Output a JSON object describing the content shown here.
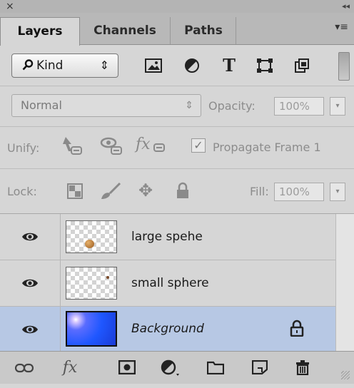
{
  "window": {
    "close_glyph": "×",
    "collapse_glyph": "◂◂"
  },
  "tabs": [
    {
      "label": "Layers",
      "active": true
    },
    {
      "label": "Channels",
      "active": false
    },
    {
      "label": "Paths",
      "active": false
    }
  ],
  "panel_menu_glyph": "▾≡",
  "filter": {
    "kind_label": "Kind",
    "kind_icon": "search-icon",
    "select_arrows": "⇕",
    "icons": [
      "pixel-layer-filter-icon",
      "adjustment-layer-filter-icon",
      "type-layer-filter-icon",
      "shape-layer-filter-icon",
      "smart-object-filter-icon"
    ],
    "type_glyph": "T"
  },
  "blend": {
    "mode": "Normal",
    "select_arrows": "⇕",
    "opacity_label": "Opacity:",
    "opacity_value": "100%",
    "dropdown_glyph": "▾"
  },
  "unify": {
    "label": "Unify:",
    "fx_glyph": "fx",
    "propagate_label": "Propagate Frame 1",
    "propagate_checked": true,
    "check_glyph": "✓"
  },
  "lock": {
    "label": "Lock:",
    "move_glyph": "✥",
    "fill_label": "Fill:",
    "fill_value": "100%",
    "dropdown_glyph": "▾"
  },
  "layers": [
    {
      "name": "large spehe",
      "visible": true,
      "selected": false,
      "locked": false,
      "italic": false
    },
    {
      "name": "small sphere",
      "visible": true,
      "selected": false,
      "locked": false,
      "italic": false
    },
    {
      "name": "Background",
      "visible": true,
      "selected": true,
      "locked": true,
      "italic": true
    }
  ],
  "bottom_toolbar": {
    "fx_glyph": "fx",
    "icons": [
      "link-layers-icon",
      "layer-style-icon",
      "layer-mask-icon",
      "adjustment-layer-icon",
      "new-group-icon",
      "new-layer-icon",
      "delete-layer-icon"
    ]
  },
  "colors": {
    "panel_bg": "#d6d6d6",
    "selected_layer_bg": "#b7c8e4",
    "tab_bar_bg": "#b8b8b8"
  }
}
